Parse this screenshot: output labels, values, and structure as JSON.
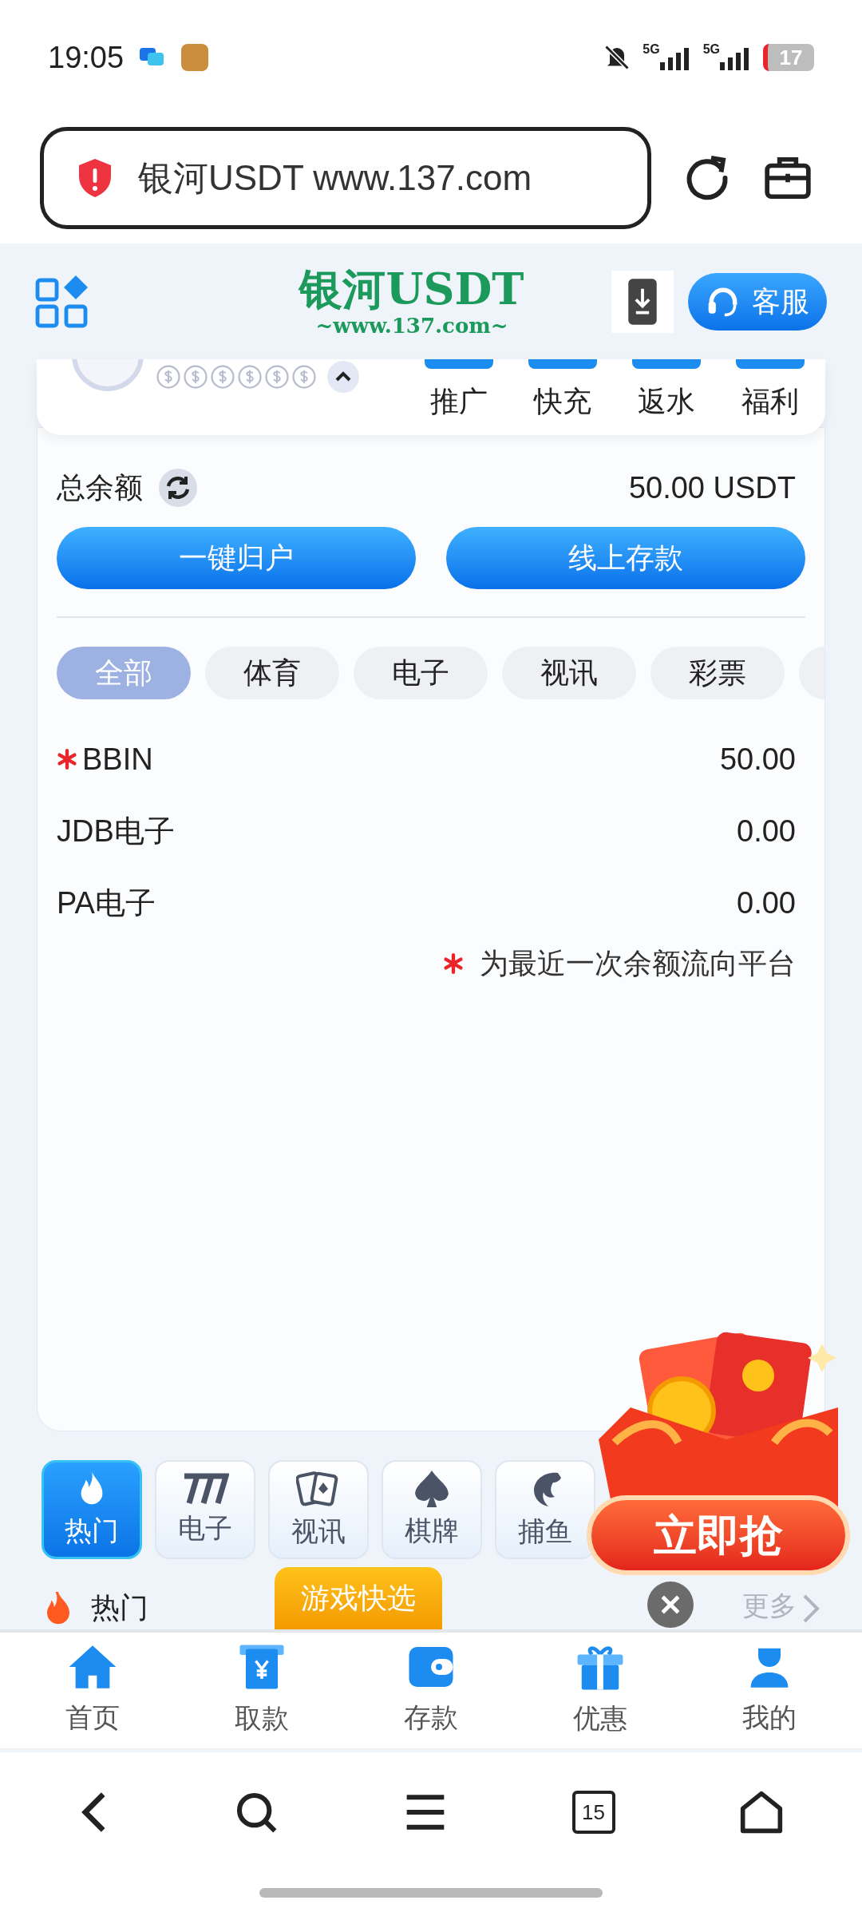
{
  "status_bar": {
    "time": "19:05",
    "battery": "17",
    "networks": [
      "5G",
      "5G"
    ]
  },
  "browser": {
    "address": "银河USDT www.137.com",
    "tab_count": "15"
  },
  "header": {
    "logo_title": "银河USDT",
    "logo_subtitle": "~www.137.com~",
    "support_label": "客服"
  },
  "shortcuts": [
    "推广",
    "快充",
    "返水",
    "福利"
  ],
  "balance": {
    "label": "总余额",
    "amount": "50.00 USDT"
  },
  "actions": [
    "一键归户",
    "线上存款"
  ],
  "filter_chips": [
    {
      "label": "全部",
      "selected": true
    },
    {
      "label": "体育",
      "selected": false
    },
    {
      "label": "电子",
      "selected": false
    },
    {
      "label": "视讯",
      "selected": false
    },
    {
      "label": "彩票",
      "selected": false
    }
  ],
  "platforms": [
    {
      "name": "BBIN",
      "amount": "50.00",
      "marked": true
    },
    {
      "name": "JDB电子",
      "amount": "0.00",
      "marked": false
    },
    {
      "name": "PA电子",
      "amount": "0.00",
      "marked": false
    }
  ],
  "note": "为最近一次余额流向平台",
  "categories": [
    {
      "label": "热门",
      "selected": true
    },
    {
      "label": "电子",
      "selected": false
    },
    {
      "label": "视讯",
      "selected": false
    },
    {
      "label": "棋牌",
      "selected": false
    },
    {
      "label": "捕鱼",
      "selected": false
    }
  ],
  "promo": {
    "button": "立即抢"
  },
  "quick_select": "游戏快选",
  "section": {
    "title": "热门",
    "more": "更多"
  },
  "bottom_nav": [
    "首页",
    "取款",
    "存款",
    "优惠",
    "我的"
  ]
}
